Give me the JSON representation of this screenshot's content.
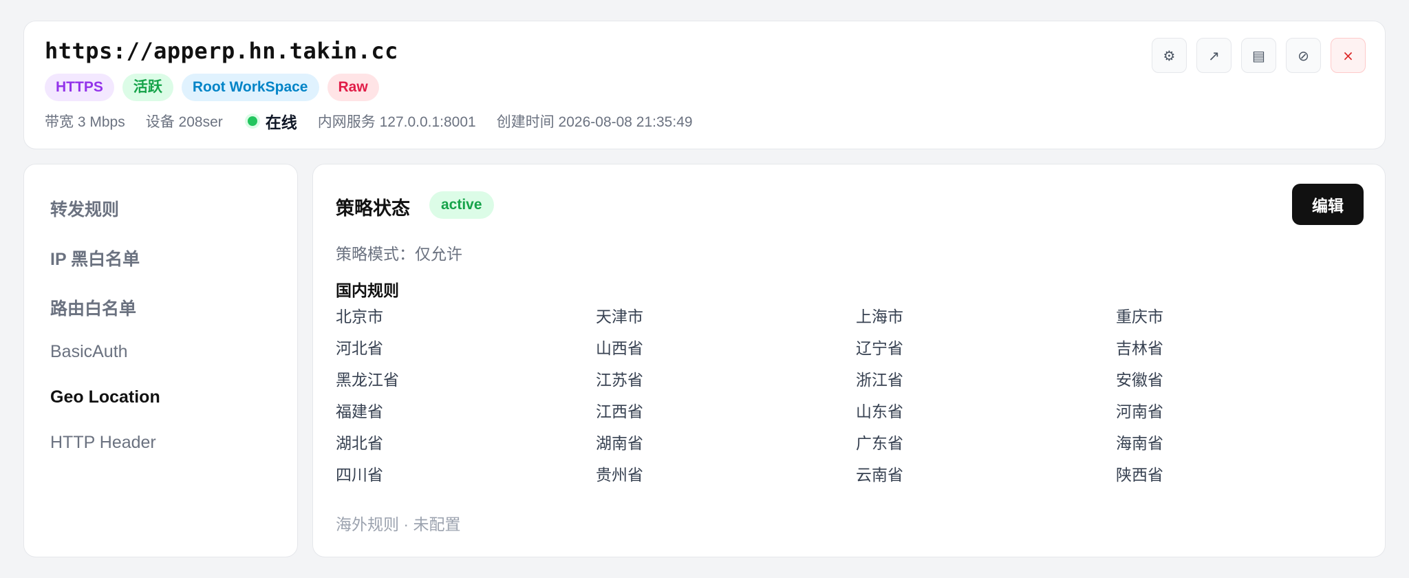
{
  "header": {
    "url": "https://apperp.hn.takin.cc",
    "badges": [
      {
        "label": "HTTPS",
        "bg": "#f3e8ff",
        "color": "#9333ea"
      },
      {
        "label": "活跃",
        "bg": "#dcfce7",
        "color": "#16a34a"
      },
      {
        "label": "Root WorkSpace",
        "bg": "#e0f2fe",
        "color": "#0284c7"
      },
      {
        "label": "Raw",
        "bg": "#ffe4e6",
        "color": "#e11d48"
      }
    ],
    "meta": {
      "bandwidth": "带宽 3 Mbps",
      "device": "设备 208ser",
      "status": "在线",
      "internal_service": "内网服务 127.0.0.1:8001",
      "created": "创建时间 2026-08-08 21:35:49"
    },
    "actions": [
      {
        "name": "settings-button",
        "icon": "gear-icon",
        "glyph": "⚙"
      },
      {
        "name": "open-external-button",
        "icon": "arrow-up-right-icon",
        "glyph": "↗"
      },
      {
        "name": "logs-button",
        "icon": "list-icon",
        "glyph": "▤"
      },
      {
        "name": "disable-button",
        "icon": "ban-icon",
        "glyph": "⊘"
      },
      {
        "name": "delete-button",
        "icon": "close-icon",
        "glyph": "×"
      }
    ]
  },
  "sidebar": {
    "items": [
      {
        "label": "转发规则",
        "active": false
      },
      {
        "label": "IP 黑白名单",
        "active": false
      },
      {
        "label": "路由白名单",
        "active": false
      },
      {
        "label": "BasicAuth",
        "active": false
      },
      {
        "label": "Geo Location",
        "active": true
      },
      {
        "label": "HTTP Header",
        "active": false
      }
    ]
  },
  "main": {
    "title": "策略状态",
    "status": "active",
    "edit_label": "编辑",
    "mode": "策略模式：仅允许",
    "domestic_title": "国内规则",
    "regions": [
      "北京市",
      "天津市",
      "上海市",
      "重庆市",
      "河北省",
      "山西省",
      "辽宁省",
      "吉林省",
      "黑龙江省",
      "江苏省",
      "浙江省",
      "安徽省",
      "福建省",
      "江西省",
      "山东省",
      "河南省",
      "湖北省",
      "湖南省",
      "广东省",
      "海南省",
      "四川省",
      "贵州省",
      "云南省",
      "陕西省"
    ],
    "overseas": "海外规则 · 未配置"
  }
}
